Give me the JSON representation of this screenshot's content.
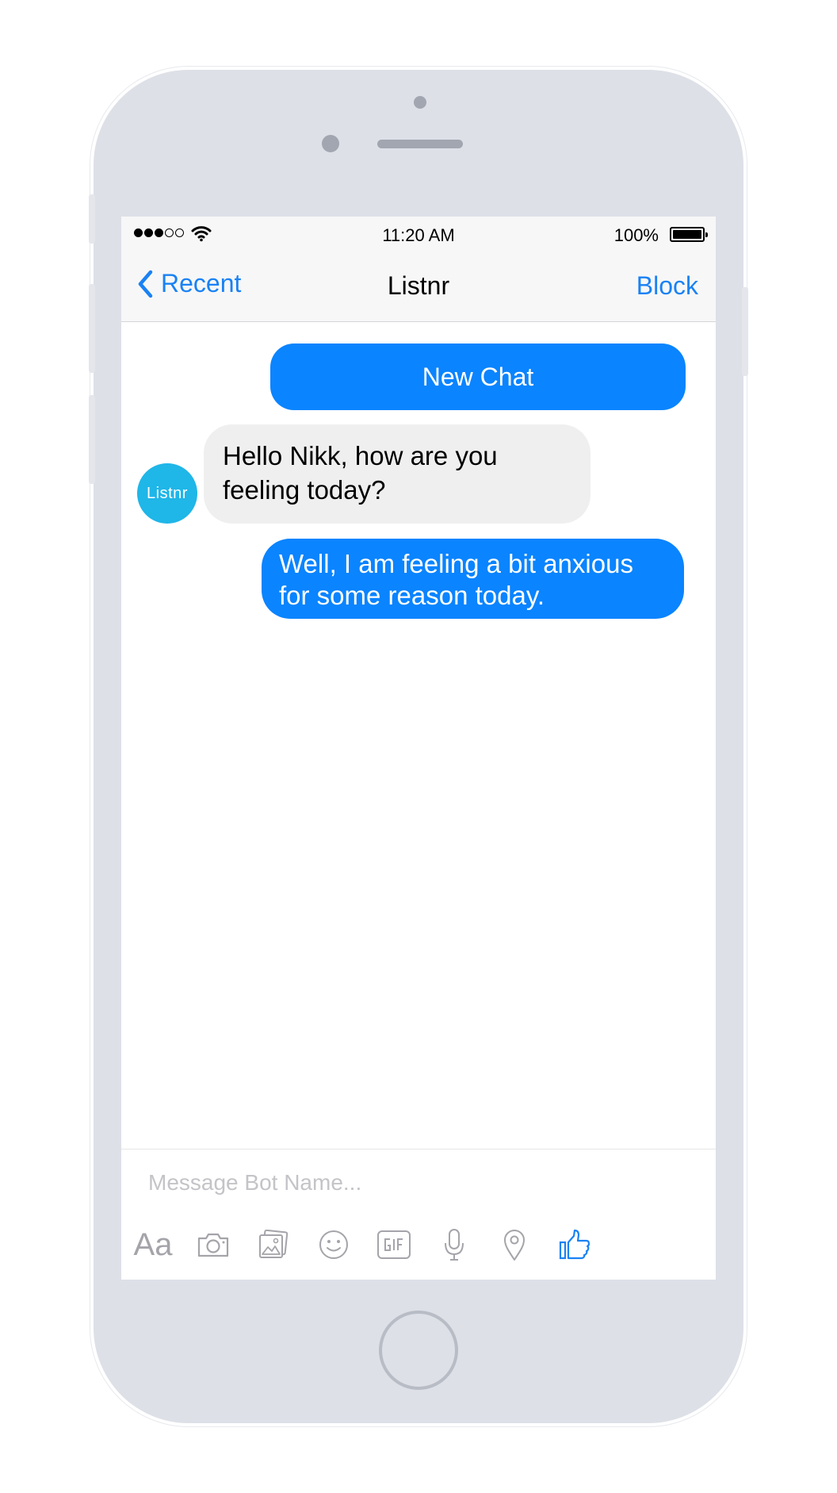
{
  "status": {
    "time": "11:20 AM",
    "battery": "100%"
  },
  "nav": {
    "back_label": "Recent",
    "title": "Listnr",
    "action_label": "Block"
  },
  "messages": {
    "new_chat_label": "New Chat",
    "bot_message": "Hello Nikk, how are you feeling today?",
    "user_message": "Well, I am feeling a bit anxious for some reason today.",
    "avatar_text": "Listnr"
  },
  "composer": {
    "placeholder": "Message Bot Name...",
    "text_toggle_label": "Aa"
  },
  "icons": [
    "back-chevron-icon",
    "wifi-icon",
    "battery-icon",
    "camera-icon",
    "photo-icon",
    "emoji-icon",
    "gif-icon",
    "microphone-icon",
    "location-icon",
    "thumbs-up-icon"
  ],
  "colors": {
    "accent": "#1a82f4",
    "bubble_out": "#0a84ff",
    "bubble_in": "#efefef",
    "avatar": "#1fb6e8",
    "phone_body": "#dde0e7",
    "icon_gray": "#a4a4aa"
  }
}
